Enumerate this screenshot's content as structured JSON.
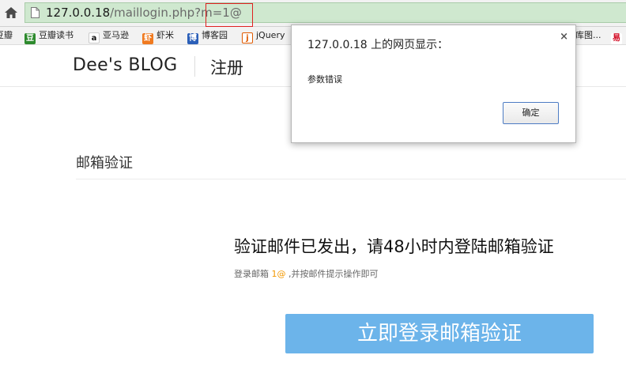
{
  "browser": {
    "url_host": "127.0.0.18",
    "url_path": "/maillogin.php?m=1@",
    "bookmarks": [
      {
        "label": "豆瓣",
        "icon": "douban-icon"
      },
      {
        "label": "豆瓣读书",
        "icon": "douban-book-icon"
      },
      {
        "label": "亚马逊",
        "icon": "amazon-icon"
      },
      {
        "label": "虾米",
        "icon": "xiami-icon"
      },
      {
        "label": "博客园",
        "icon": "cnblogs-icon"
      },
      {
        "label": "jQuery",
        "icon": "jquery-icon"
      },
      {
        "label": "库图...",
        "icon": "bookmark-icon"
      },
      {
        "label": "易",
        "icon": "netease-icon"
      }
    ]
  },
  "site": {
    "brand": "Dee's BLOG",
    "nav_register": "注册"
  },
  "main": {
    "section_title": "邮箱验证",
    "sent_message": "验证邮件已发出，请48小时内登陆邮箱验证",
    "hint_prefix": "登录邮箱",
    "hint_email": "1@",
    "hint_suffix": ",并按邮件提示操作即可",
    "login_button": "立即登录邮箱验证"
  },
  "dialog": {
    "title": "127.0.0.18 上的网页显示：",
    "close": "×",
    "message": "参数错误",
    "ok_button": "确定"
  },
  "colors": {
    "button_blue": "#6cb4ea",
    "email_highlight": "#f39800",
    "url_bar_green": "#cfe8cf",
    "annotation_red": "#e02020"
  }
}
